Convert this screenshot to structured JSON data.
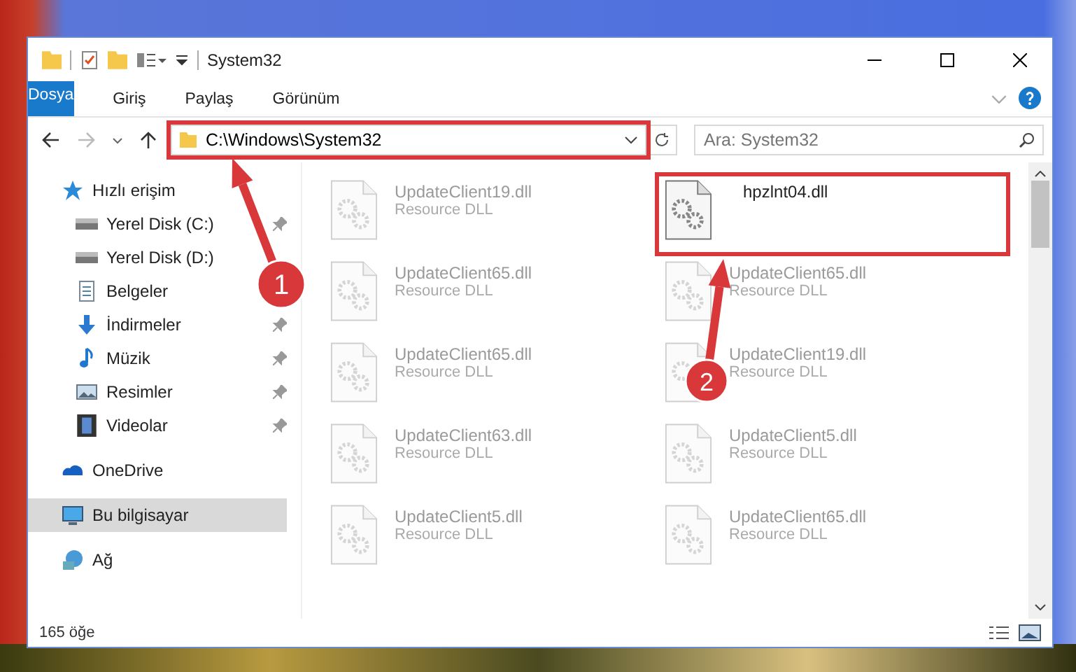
{
  "window": {
    "title": "System32"
  },
  "ribbon_tabs": [
    {
      "label": "Dosya",
      "kind": "file"
    },
    {
      "label": "Giriş",
      "kind": "tab"
    },
    {
      "label": "Paylaş",
      "kind": "tab"
    },
    {
      "label": "Görünüm",
      "kind": "tab"
    }
  ],
  "address": {
    "value": "C:\\Windows\\System32",
    "highlighted": true
  },
  "search": {
    "placeholder": "Ara: System32"
  },
  "sidebar": {
    "items": [
      {
        "label": "Hızlı erişim",
        "pinned": false,
        "selected": false,
        "kind": "group"
      },
      {
        "label": "Yerel Disk (C:)",
        "pinned": true,
        "selected": false,
        "kind": "child"
      },
      {
        "label": "Yerel Disk (D:)",
        "pinned": false,
        "selected": false,
        "kind": "child"
      },
      {
        "label": "Belgeler",
        "pinned": false,
        "selected": false,
        "kind": "child"
      },
      {
        "label": "İndirmeler",
        "pinned": true,
        "selected": false,
        "kind": "child"
      },
      {
        "label": "Müzik",
        "pinned": true,
        "selected": false,
        "kind": "child"
      },
      {
        "label": "Resimler",
        "pinned": true,
        "selected": false,
        "kind": "child"
      },
      {
        "label": "Videolar",
        "pinned": true,
        "selected": false,
        "kind": "child"
      },
      {
        "label": "OneDrive",
        "pinned": false,
        "selected": false,
        "kind": "group"
      },
      {
        "label": "Bu bilgisayar",
        "pinned": false,
        "selected": true,
        "kind": "group"
      },
      {
        "label": "Ağ",
        "pinned": false,
        "selected": false,
        "kind": "group"
      }
    ]
  },
  "files": [
    {
      "name": "UpdateClient19.dll",
      "type": "Resource DLL",
      "dimmed": true,
      "highlighted": false
    },
    {
      "name": "hpzlnt04.dll",
      "dimmed": false,
      "highlighted": true
    },
    {
      "name": "UpdateClient65.dll",
      "type": "Resource DLL",
      "dimmed": true,
      "highlighted": false
    },
    {
      "name": "UpdateClient65.dll",
      "type": "Resource DLL",
      "dimmed": true,
      "highlighted": false
    },
    {
      "name": "UpdateClient65.dll",
      "type": "Resource DLL",
      "dimmed": true,
      "highlighted": false
    },
    {
      "name": "UpdateClient19.dll",
      "type": "Resource DLL",
      "dimmed": true,
      "highlighted": false
    },
    {
      "name": "UpdateClient63.dll",
      "type": "Resource DLL",
      "dimmed": true,
      "highlighted": false
    },
    {
      "name": "UpdateClient5.dll",
      "type": "Resource DLL",
      "dimmed": true,
      "highlighted": false
    },
    {
      "name": "UpdateClient5.dll",
      "type": "Resource DLL",
      "dimmed": true,
      "highlighted": false
    },
    {
      "name": "UpdateClient65.dll",
      "type": "Resource DLL",
      "dimmed": true,
      "highlighted": false
    }
  ],
  "status_bar": {
    "count": "165 öğe"
  },
  "annotations": [
    {
      "number": "1"
    },
    {
      "number": "2"
    }
  ]
}
